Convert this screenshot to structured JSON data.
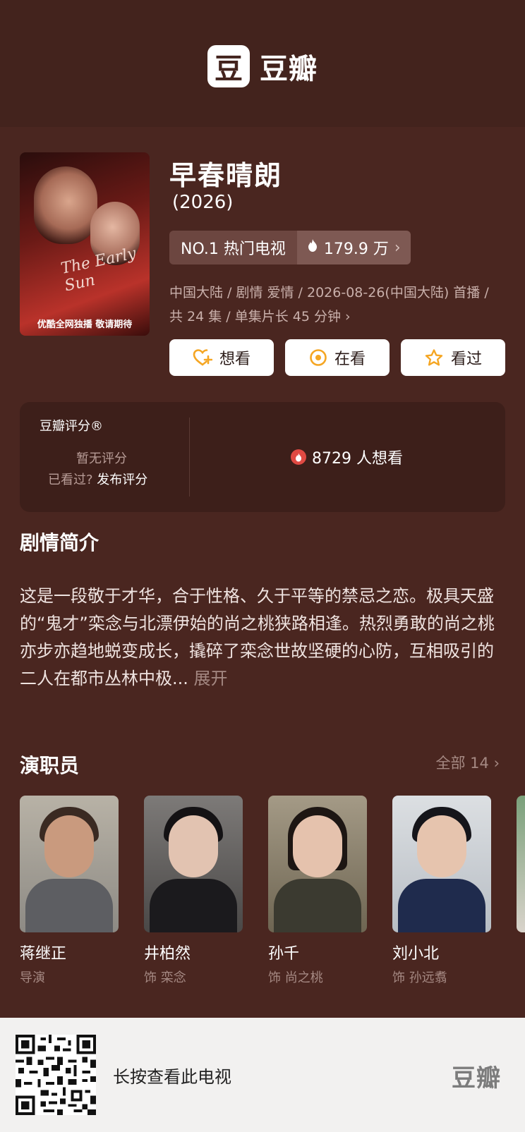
{
  "header": {
    "logo_mark": "豆",
    "logo_text": "豆瓣"
  },
  "poster": {
    "script_text": "The Early Sun",
    "caption": "优酷全网独播 敬请期待"
  },
  "movie": {
    "title": "早春晴朗",
    "year": "(2026)",
    "rank_label": "NO.1 热门电视",
    "heat": "179.9 万",
    "meta": "中国大陆 / 剧情 爱情 / 2026-08-26(中国大陆) 首播 / 共 24 集 / 单集片长 45 分钟"
  },
  "actions": {
    "want": "想看",
    "watching": "在看",
    "watched": "看过"
  },
  "rating": {
    "title": "豆瓣评分®",
    "none": "暂无评分",
    "seen_prompt": "已看过?",
    "post": "发布评分",
    "want_count": "8729 人想看"
  },
  "synopsis": {
    "title": "剧情简介",
    "text": "这是一段敬于才华，合于性格、久于平等的禁忌之恋。极具天盛的“鬼才”栾念与北漂伊始的尚之桃狭路相逢。热烈勇敢的尚之桃亦步亦趋地蜕变成长，撬碎了栾念世故坚硬的心防，互相吸引的二人在都市丛林中极...",
    "expand": "展开"
  },
  "cast": {
    "title": "演职员",
    "all_link": "全部 14",
    "members": [
      {
        "name": "蒋继正",
        "role": "导演"
      },
      {
        "name": "井柏然",
        "role": "饰 栾念"
      },
      {
        "name": "孙千",
        "role": "饰 尚之桃"
      },
      {
        "name": "刘小北",
        "role": "饰 孙远翥"
      }
    ]
  },
  "footer": {
    "text": "长按查看此电视",
    "logo": "豆瓣"
  },
  "colors": {
    "background": "#4a2620",
    "header": "#43231d",
    "accent_orange": "#f5a623",
    "fire_red": "#e04a43"
  }
}
